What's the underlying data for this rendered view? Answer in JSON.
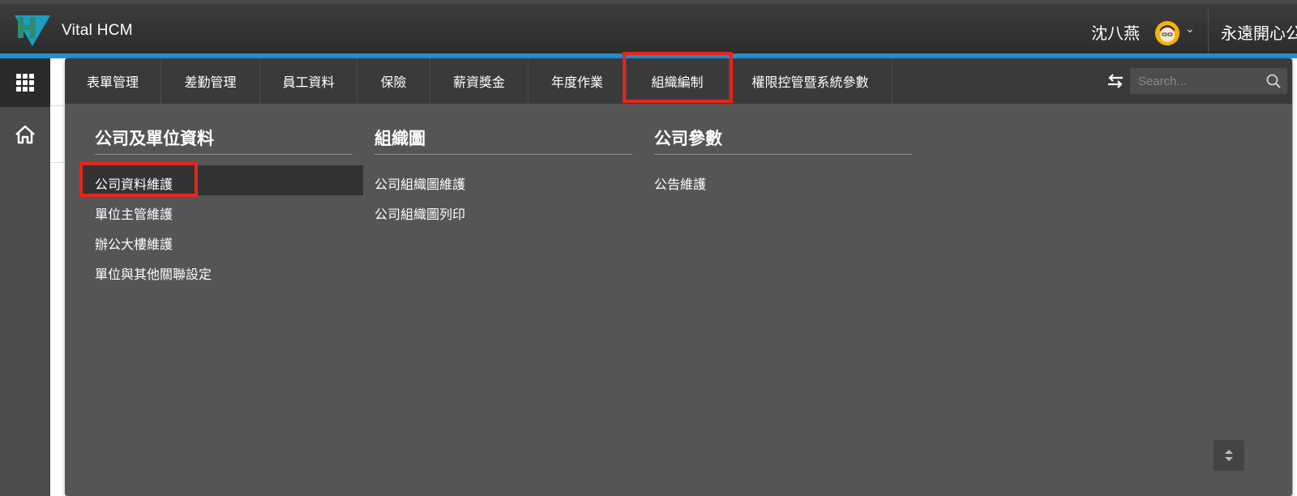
{
  "app": {
    "title": "Vital HCM"
  },
  "header": {
    "user_name": "沈八燕",
    "company_name": "永遠開心公"
  },
  "menu": {
    "tabs": [
      {
        "label": "表單管理"
      },
      {
        "label": "差勤管理"
      },
      {
        "label": "員工資料"
      },
      {
        "label": "保險"
      },
      {
        "label": "薪資獎金"
      },
      {
        "label": "年度作業"
      },
      {
        "label": "組織編制",
        "active": true
      },
      {
        "label": "權限控管暨系統參數"
      }
    ],
    "search": {
      "placeholder": "Search..."
    },
    "sections": [
      {
        "title": "公司及單位資料",
        "items": [
          "公司資料維護",
          "單位主管維護",
          "辦公大樓維護",
          "單位與其他關聯設定"
        ]
      },
      {
        "title": "組織圖",
        "items": [
          "公司組織圖維護",
          "公司組織圖列印"
        ]
      },
      {
        "title": "公司參數",
        "items": [
          "公告維護"
        ]
      }
    ],
    "selected_item": "公司資料維護"
  },
  "colors": {
    "topbar": "#2f2f2f",
    "accent_blue": "#1f8fd6",
    "panel_bg": "#555555",
    "tabbar_bg": "#3a3a3a",
    "highlight_red": "#e8241c",
    "avatar_yellow": "#f4b400"
  },
  "icons": [
    "logo-icon",
    "apps-grid-icon",
    "home-icon",
    "chevron-down-icon",
    "swap-icon",
    "search-icon",
    "scroll-toggle-icon"
  ]
}
